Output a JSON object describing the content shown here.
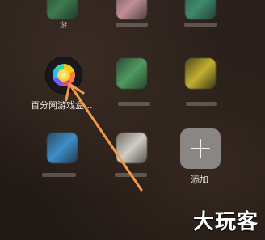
{
  "apps": {
    "featured": {
      "label": "百分网游戏盒..."
    },
    "add": {
      "label": "添加"
    },
    "partial_top_label": "游"
  },
  "watermark": "大玩客",
  "colors": {
    "arrow": "#f39a4a",
    "add_tile": "#8a8683"
  }
}
